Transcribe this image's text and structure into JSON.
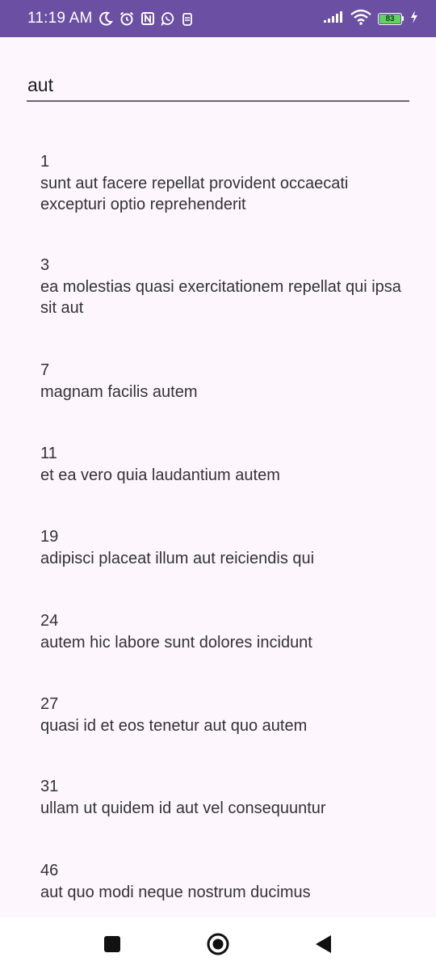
{
  "status_bar": {
    "time": "11:19 AM",
    "battery_level": "83",
    "icons": [
      "moon-icon",
      "alarm-icon",
      "nfc-icon",
      "whatsapp-icon",
      "app-notification-icon",
      "signal-icon",
      "wifi-icon",
      "battery-icon",
      "charging-icon"
    ],
    "colors": {
      "background": "#6a4fa3",
      "battery_fill": "#5fd35f"
    }
  },
  "search": {
    "value": "aut"
  },
  "results": [
    {
      "id": "1",
      "title": "sunt aut facere repellat provident occaecati excepturi optio reprehenderit"
    },
    {
      "id": "3",
      "title": "ea molestias quasi exercitationem repellat qui ipsa sit aut"
    },
    {
      "id": "7",
      "title": "magnam facilis autem"
    },
    {
      "id": "11",
      "title": "et ea vero quia laudantium autem"
    },
    {
      "id": "19",
      "title": "adipisci placeat illum aut reiciendis qui"
    },
    {
      "id": "24",
      "title": "autem hic labore sunt dolores incidunt"
    },
    {
      "id": "27",
      "title": "quasi id et eos tenetur aut quo autem"
    },
    {
      "id": "31",
      "title": "ullam ut quidem id aut vel consequuntur"
    },
    {
      "id": "46",
      "title": "aut quo modi neque nostrum ducimus"
    }
  ],
  "nav_bar": {
    "buttons": [
      "recents-square-icon",
      "home-circle-icon",
      "back-triangle-icon"
    ]
  }
}
